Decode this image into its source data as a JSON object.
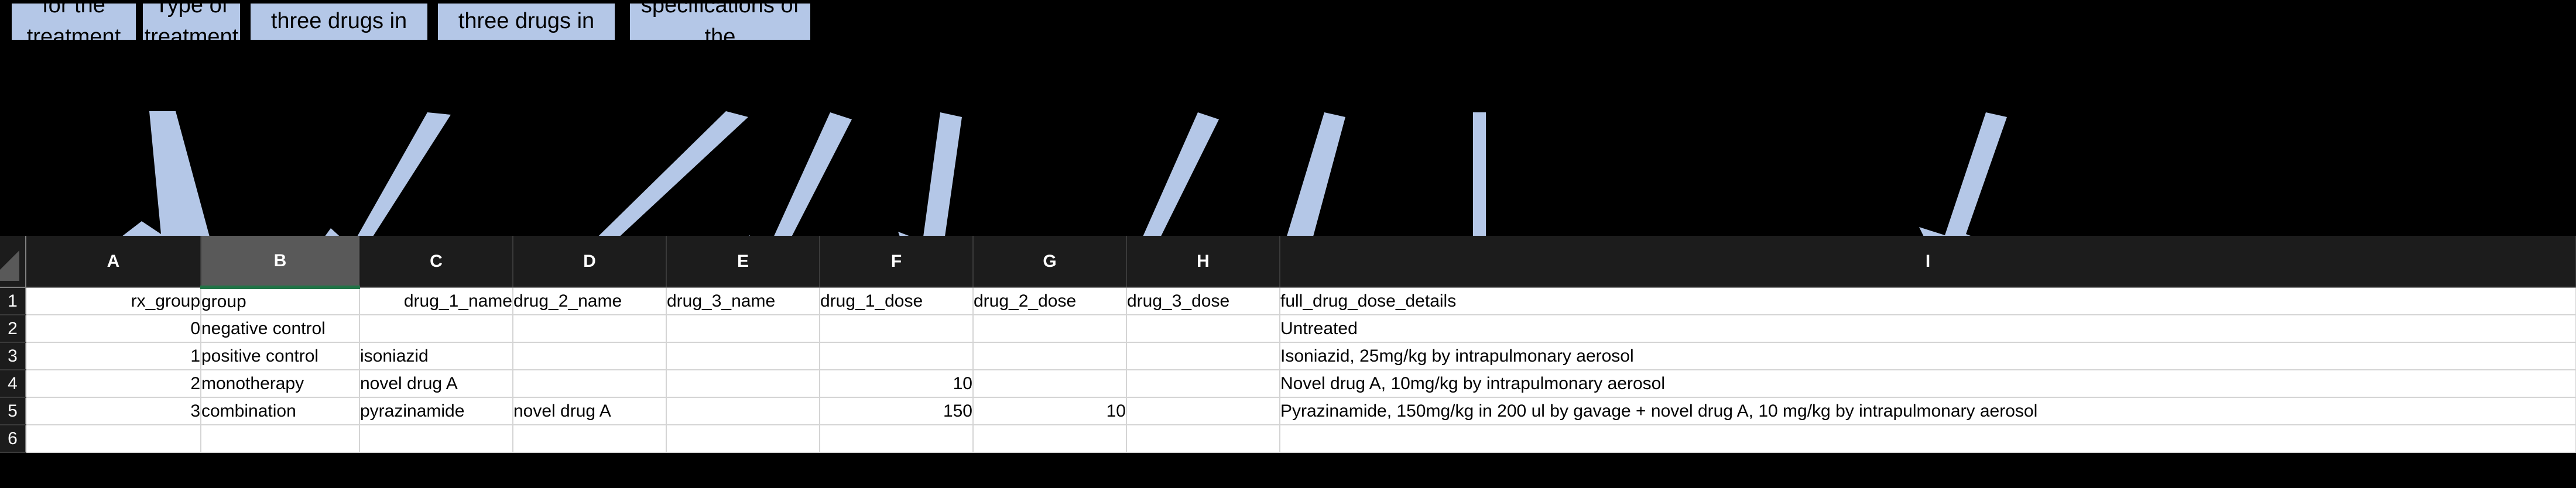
{
  "annotations": {
    "boxes": [
      {
        "id": "identifier",
        "text": "Identifier for the\ntreatment group"
      },
      {
        "id": "type",
        "text": "Type of\ntreatment"
      },
      {
        "id": "names",
        "text": "Names of up to three drugs in\nthe treatment"
      },
      {
        "id": "doses",
        "text": "Doses of up to three drugs in\nthe treatment"
      },
      {
        "id": "fullspec",
        "text": "Full specifications of the\ntreatment"
      }
    ],
    "box_fill": "#B4C7E7",
    "arrow_fill": "#B4C7E7",
    "arrow_count": 9
  },
  "spreadsheet": {
    "selected_column": "B",
    "selection_accent": "#217346",
    "column_letters": [
      "A",
      "B",
      "C",
      "D",
      "E",
      "F",
      "G",
      "H",
      "I"
    ],
    "row_numbers": [
      "1",
      "2",
      "3",
      "4",
      "5",
      "6"
    ],
    "headers": [
      "rx_group",
      "group",
      "drug_1_name",
      "drug_2_name",
      "drug_3_name",
      "drug_1_dose",
      "drug_2_dose",
      "drug_3_dose",
      "full_drug_dose_details"
    ],
    "rows": [
      {
        "rx_group": "0",
        "group": "negative control",
        "drug_1_name": "",
        "drug_2_name": "",
        "drug_3_name": "",
        "drug_1_dose": "",
        "drug_2_dose": "",
        "drug_3_dose": "",
        "full_drug_dose_details": "Untreated"
      },
      {
        "rx_group": "1",
        "group": "positive control",
        "drug_1_name": "isoniazid",
        "drug_2_name": "",
        "drug_3_name": "",
        "drug_1_dose": "",
        "drug_2_dose": "",
        "drug_3_dose": "",
        "full_drug_dose_details": "Isoniazid, 25mg/kg by intrapulmonary aerosol"
      },
      {
        "rx_group": "2",
        "group": "monotherapy",
        "drug_1_name": "novel drug A",
        "drug_2_name": "",
        "drug_3_name": "",
        "drug_1_dose": "10",
        "drug_2_dose": "",
        "drug_3_dose": "",
        "full_drug_dose_details": "Novel drug A, 10mg/kg by intrapulmonary aerosol"
      },
      {
        "rx_group": "3",
        "group": "combination",
        "drug_1_name": "pyrazinamide",
        "drug_2_name": "novel drug A",
        "drug_3_name": "",
        "drug_1_dose": "150",
        "drug_2_dose": "10",
        "drug_3_dose": "",
        "full_drug_dose_details": "Pyrazinamide, 150mg/kg in 200 ul by gavage + novel drug A, 10 mg/kg by intrapulmonary aerosol"
      }
    ]
  }
}
